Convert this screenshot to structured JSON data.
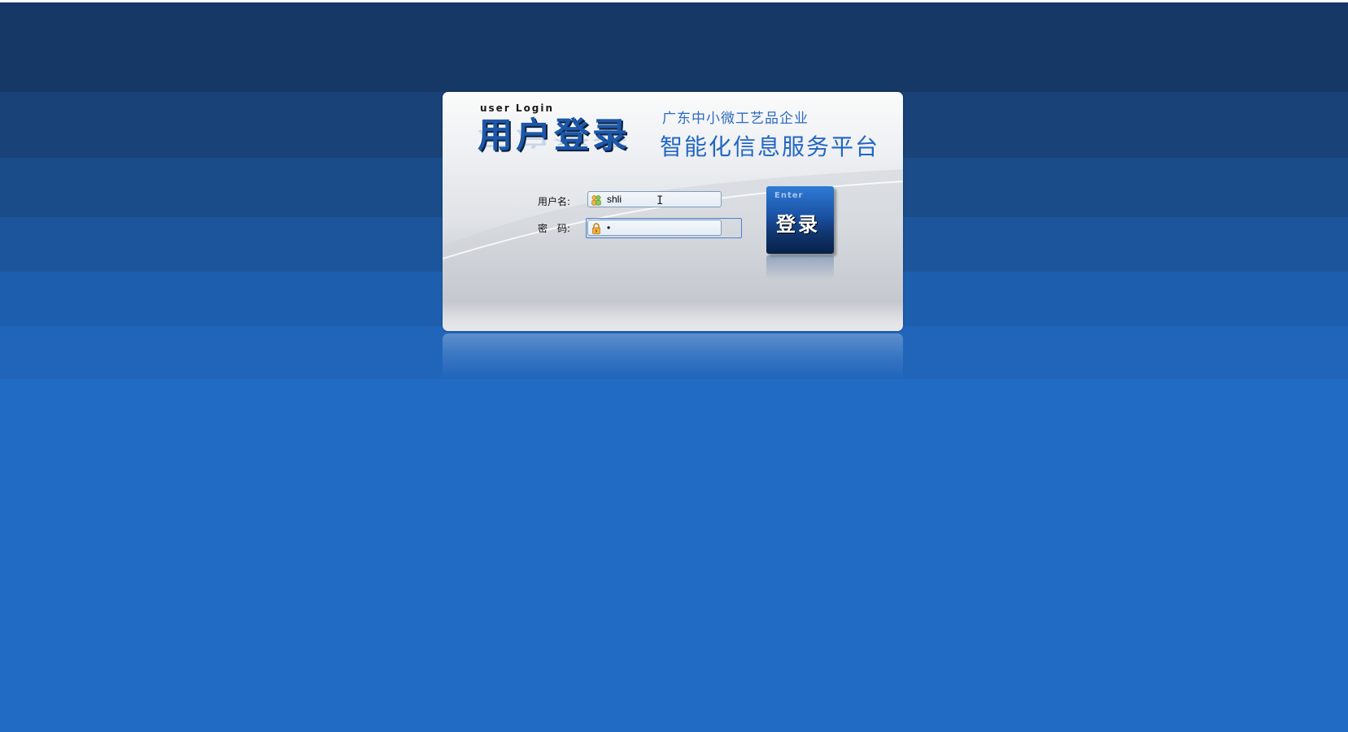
{
  "login": {
    "heading_en": "user Login",
    "heading_cn": "用户登录",
    "subtitle": "广东中小微工艺品企业",
    "title": "智能化信息服务平台",
    "username_label": "用户名:",
    "password_label": "密　码:",
    "username_value": "shli",
    "password_value": "•",
    "enter_label_en": "Enter",
    "enter_label_cn": "登录"
  },
  "colors": {
    "accent": "#2166c4",
    "background": "#216bc4",
    "dark_band": "#163866"
  },
  "icons": {
    "username": "users-icon",
    "password": "lock-icon",
    "cursor": "text-cursor-icon"
  }
}
